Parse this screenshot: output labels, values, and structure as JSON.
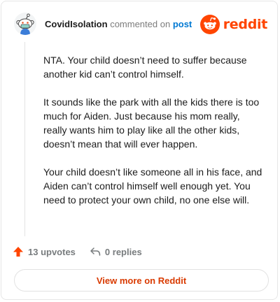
{
  "header": {
    "username": "CovidIsolation",
    "action_text": "commented on",
    "post_link": "post",
    "brand": "reddit"
  },
  "comment": {
    "paragraphs": [
      "NTA. Your child doesn’t need to suffer because another kid can’t control himself.",
      "It sounds like the park with all the kids there is too much for Aiden. Just because his mom really, really wants him to play like all the other kids, doesn’t mean that will ever happen.",
      "Your child doesn’t like someone all in his face, and Aiden can’t control himself well enough yet. You need to protect your own child, no one else will."
    ]
  },
  "actions": {
    "upvotes_label": "13 upvotes",
    "replies_label": "0 replies"
  },
  "footer": {
    "view_more_label": "View more on Reddit"
  },
  "colors": {
    "accent": "#ff4500",
    "link": "#0079d3",
    "view_more": "#d93a00",
    "text": "#1c1c1c",
    "muted": "#787c7e"
  },
  "icons": [
    "snoo-avatar-icon",
    "reddit-logo-icon",
    "upvote-arrow-icon",
    "reply-arrow-icon"
  ]
}
